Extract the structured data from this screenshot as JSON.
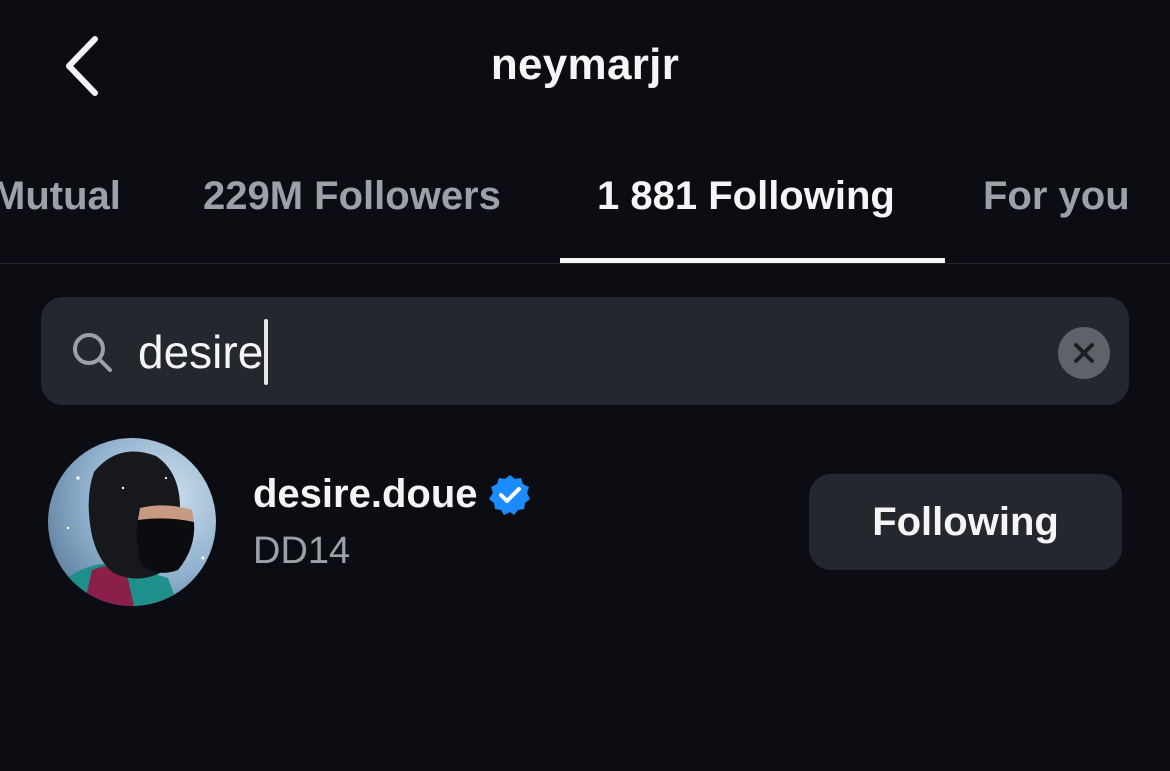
{
  "header": {
    "title": "neymarjr",
    "back_icon": "chevron-left-icon"
  },
  "tabs": [
    {
      "label": "Mutual",
      "active": false
    },
    {
      "label": "229M Followers",
      "active": false
    },
    {
      "label": "1 881 Following",
      "active": true
    },
    {
      "label": "For you",
      "active": false
    }
  ],
  "search": {
    "value": "desire",
    "icon": "search-icon",
    "clear_icon": "clear-icon"
  },
  "results": [
    {
      "username": "desire.doue",
      "full_name": "DD14",
      "verified": true,
      "button_label": "Following"
    }
  ],
  "colors": {
    "background": "#0b0d12",
    "surface": "#24272d",
    "text_primary": "#f5f5f5",
    "text_secondary": "#9aa1ab",
    "verified_blue": "#1a8cff"
  }
}
